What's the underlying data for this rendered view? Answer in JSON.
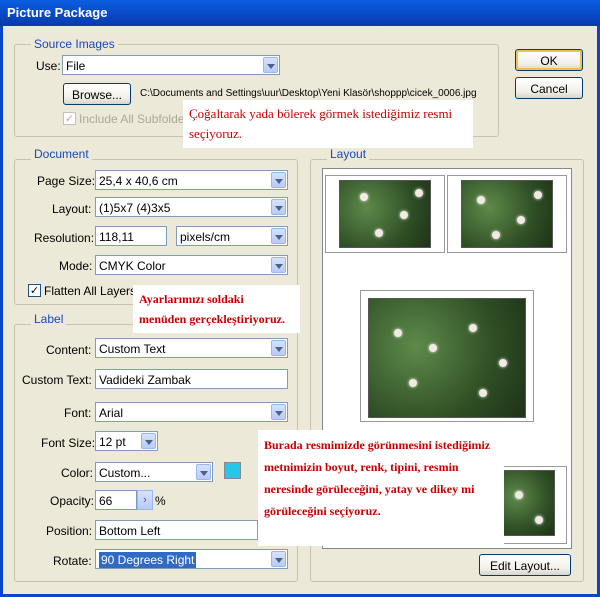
{
  "window": {
    "title": "Picture Package"
  },
  "buttons": {
    "ok": "OK",
    "cancel": "Cancel",
    "browse": "Browse...",
    "edit_layout": "Edit Layout..."
  },
  "source": {
    "legend": "Source Images",
    "use_label": "Use:",
    "use_value": "File",
    "path": "C:\\Documents and Settings\\uur\\Desktop\\Yeni Klasör\\shoppp\\cicek_0006.jpg",
    "include_label": "Include All Subfolders",
    "include_checked": true
  },
  "document": {
    "legend": "Document",
    "page_size_label": "Page Size:",
    "page_size_value": "25,4 x 40,6 cm",
    "layout_label": "Layout:",
    "layout_value": "(1)5x7 (4)3x5",
    "resolution_label": "Resolution:",
    "resolution_value": "118,11",
    "resolution_unit": "pixels/cm",
    "mode_label": "Mode:",
    "mode_value": "CMYK Color",
    "flatten_label": "Flatten All Layers",
    "flatten_checked": true
  },
  "label": {
    "legend": "Label",
    "content_label": "Content:",
    "content_value": "Custom Text",
    "custom_text_label": "Custom Text:",
    "custom_text_value": "Vadideki Zambak",
    "font_label": "Font:",
    "font_value": "Arial",
    "font_size_label": "Font Size:",
    "font_size_value": "12 pt",
    "color_label": "Color:",
    "color_value": "Custom...",
    "color_swatch": "#26C6E8",
    "opacity_label": "Opacity:",
    "opacity_value": "66",
    "opacity_unit": "%",
    "position_label": "Position:",
    "position_value": "Bottom Left",
    "rotate_label": "Rotate:",
    "rotate_value": "90 Degrees Right"
  },
  "layout_panel": {
    "legend": "Layout"
  },
  "annotations": {
    "note1": "Çoğaltarak yada bölerek  görmek istediğimiz resmi seçiyoruz.",
    "note2": "Ayarlarımızı soldaki menüden gerçekleştiriyoruz.",
    "note3": "Burada resmimizde görünmesini istediğimiz metnimizin boyut, renk, tipini, resmin neresinde görüleceğini, yatay ve dikey mi görüleceğini seçiyoruz."
  }
}
